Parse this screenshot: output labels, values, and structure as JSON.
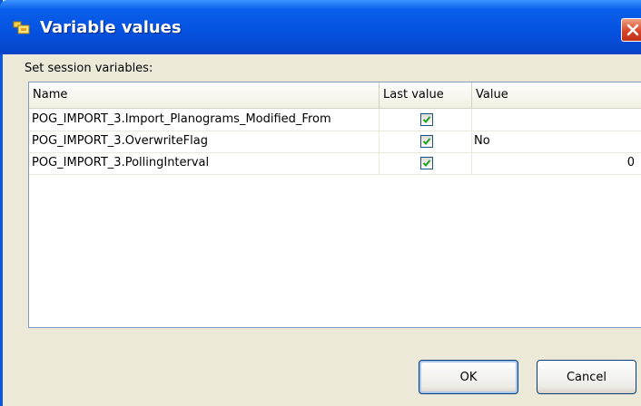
{
  "window": {
    "title": "Variable values",
    "section_label": "Set session variables:"
  },
  "table": {
    "columns": [
      "Name",
      "Last value",
      "Value"
    ],
    "rows": [
      {
        "name": "POG_IMPORT_3.Import_Planograms_Modified_From",
        "last_value": true,
        "value": ""
      },
      {
        "name": "POG_IMPORT_3.OverwriteFlag",
        "last_value": true,
        "value": "No"
      },
      {
        "name": "POG_IMPORT_3.PollingInterval",
        "last_value": true,
        "value": "0"
      }
    ]
  },
  "buttons": {
    "ok": "OK",
    "cancel": "Cancel"
  },
  "icons": {
    "title": "variables-icon",
    "close": "close-icon",
    "check": "checkmark-icon"
  },
  "colors": {
    "titlebar": "#0553e1",
    "dialog_bg": "#ece9d8",
    "close": "#d9452a",
    "check": "#21a121"
  }
}
